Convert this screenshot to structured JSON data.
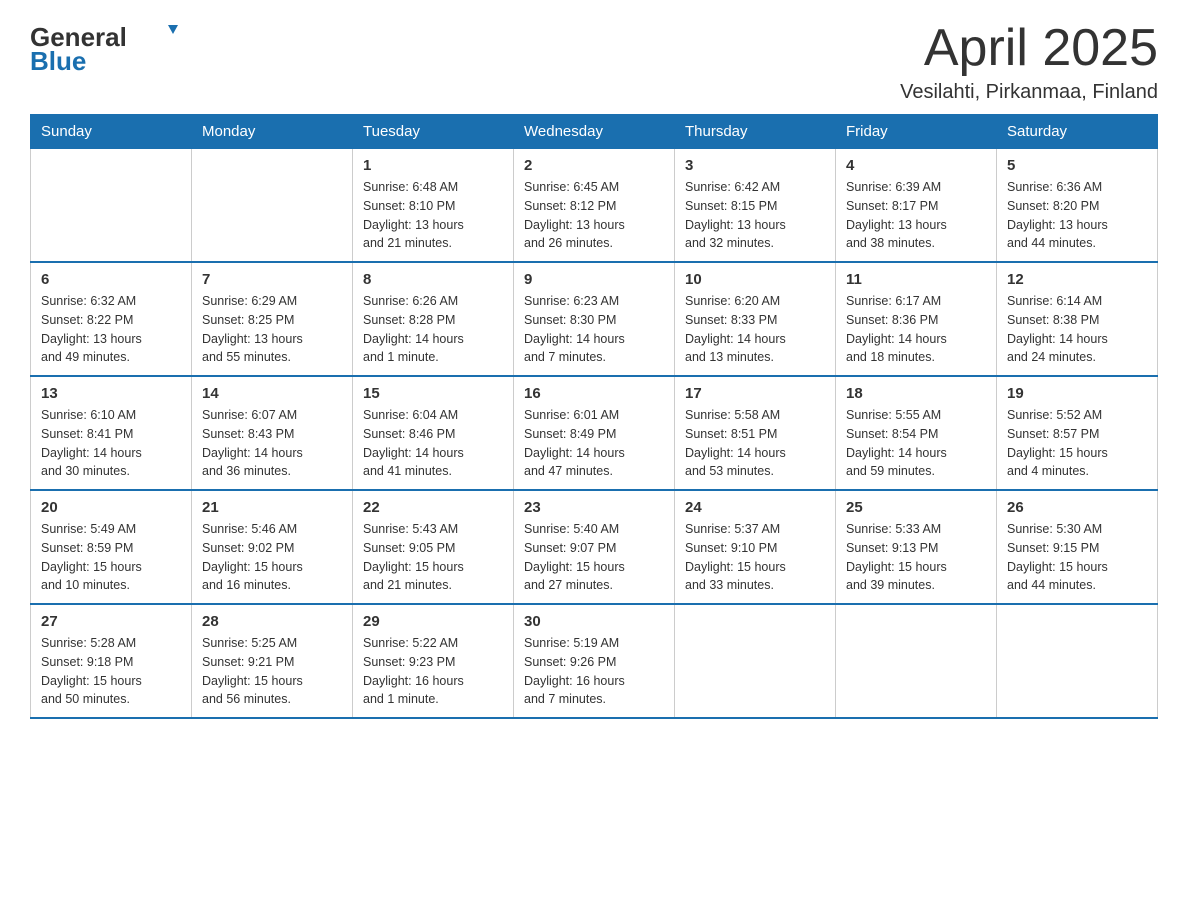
{
  "header": {
    "logo_general": "General",
    "logo_blue": "Blue",
    "title": "April 2025",
    "subtitle": "Vesilahti, Pirkanmaa, Finland"
  },
  "calendar": {
    "days_of_week": [
      "Sunday",
      "Monday",
      "Tuesday",
      "Wednesday",
      "Thursday",
      "Friday",
      "Saturday"
    ],
    "weeks": [
      [
        {
          "day": "",
          "info": ""
        },
        {
          "day": "",
          "info": ""
        },
        {
          "day": "1",
          "info": "Sunrise: 6:48 AM\nSunset: 8:10 PM\nDaylight: 13 hours\nand 21 minutes."
        },
        {
          "day": "2",
          "info": "Sunrise: 6:45 AM\nSunset: 8:12 PM\nDaylight: 13 hours\nand 26 minutes."
        },
        {
          "day": "3",
          "info": "Sunrise: 6:42 AM\nSunset: 8:15 PM\nDaylight: 13 hours\nand 32 minutes."
        },
        {
          "day": "4",
          "info": "Sunrise: 6:39 AM\nSunset: 8:17 PM\nDaylight: 13 hours\nand 38 minutes."
        },
        {
          "day": "5",
          "info": "Sunrise: 6:36 AM\nSunset: 8:20 PM\nDaylight: 13 hours\nand 44 minutes."
        }
      ],
      [
        {
          "day": "6",
          "info": "Sunrise: 6:32 AM\nSunset: 8:22 PM\nDaylight: 13 hours\nand 49 minutes."
        },
        {
          "day": "7",
          "info": "Sunrise: 6:29 AM\nSunset: 8:25 PM\nDaylight: 13 hours\nand 55 minutes."
        },
        {
          "day": "8",
          "info": "Sunrise: 6:26 AM\nSunset: 8:28 PM\nDaylight: 14 hours\nand 1 minute."
        },
        {
          "day": "9",
          "info": "Sunrise: 6:23 AM\nSunset: 8:30 PM\nDaylight: 14 hours\nand 7 minutes."
        },
        {
          "day": "10",
          "info": "Sunrise: 6:20 AM\nSunset: 8:33 PM\nDaylight: 14 hours\nand 13 minutes."
        },
        {
          "day": "11",
          "info": "Sunrise: 6:17 AM\nSunset: 8:36 PM\nDaylight: 14 hours\nand 18 minutes."
        },
        {
          "day": "12",
          "info": "Sunrise: 6:14 AM\nSunset: 8:38 PM\nDaylight: 14 hours\nand 24 minutes."
        }
      ],
      [
        {
          "day": "13",
          "info": "Sunrise: 6:10 AM\nSunset: 8:41 PM\nDaylight: 14 hours\nand 30 minutes."
        },
        {
          "day": "14",
          "info": "Sunrise: 6:07 AM\nSunset: 8:43 PM\nDaylight: 14 hours\nand 36 minutes."
        },
        {
          "day": "15",
          "info": "Sunrise: 6:04 AM\nSunset: 8:46 PM\nDaylight: 14 hours\nand 41 minutes."
        },
        {
          "day": "16",
          "info": "Sunrise: 6:01 AM\nSunset: 8:49 PM\nDaylight: 14 hours\nand 47 minutes."
        },
        {
          "day": "17",
          "info": "Sunrise: 5:58 AM\nSunset: 8:51 PM\nDaylight: 14 hours\nand 53 minutes."
        },
        {
          "day": "18",
          "info": "Sunrise: 5:55 AM\nSunset: 8:54 PM\nDaylight: 14 hours\nand 59 minutes."
        },
        {
          "day": "19",
          "info": "Sunrise: 5:52 AM\nSunset: 8:57 PM\nDaylight: 15 hours\nand 4 minutes."
        }
      ],
      [
        {
          "day": "20",
          "info": "Sunrise: 5:49 AM\nSunset: 8:59 PM\nDaylight: 15 hours\nand 10 minutes."
        },
        {
          "day": "21",
          "info": "Sunrise: 5:46 AM\nSunset: 9:02 PM\nDaylight: 15 hours\nand 16 minutes."
        },
        {
          "day": "22",
          "info": "Sunrise: 5:43 AM\nSunset: 9:05 PM\nDaylight: 15 hours\nand 21 minutes."
        },
        {
          "day": "23",
          "info": "Sunrise: 5:40 AM\nSunset: 9:07 PM\nDaylight: 15 hours\nand 27 minutes."
        },
        {
          "day": "24",
          "info": "Sunrise: 5:37 AM\nSunset: 9:10 PM\nDaylight: 15 hours\nand 33 minutes."
        },
        {
          "day": "25",
          "info": "Sunrise: 5:33 AM\nSunset: 9:13 PM\nDaylight: 15 hours\nand 39 minutes."
        },
        {
          "day": "26",
          "info": "Sunrise: 5:30 AM\nSunset: 9:15 PM\nDaylight: 15 hours\nand 44 minutes."
        }
      ],
      [
        {
          "day": "27",
          "info": "Sunrise: 5:28 AM\nSunset: 9:18 PM\nDaylight: 15 hours\nand 50 minutes."
        },
        {
          "day": "28",
          "info": "Sunrise: 5:25 AM\nSunset: 9:21 PM\nDaylight: 15 hours\nand 56 minutes."
        },
        {
          "day": "29",
          "info": "Sunrise: 5:22 AM\nSunset: 9:23 PM\nDaylight: 16 hours\nand 1 minute."
        },
        {
          "day": "30",
          "info": "Sunrise: 5:19 AM\nSunset: 9:26 PM\nDaylight: 16 hours\nand 7 minutes."
        },
        {
          "day": "",
          "info": ""
        },
        {
          "day": "",
          "info": ""
        },
        {
          "day": "",
          "info": ""
        }
      ]
    ]
  }
}
